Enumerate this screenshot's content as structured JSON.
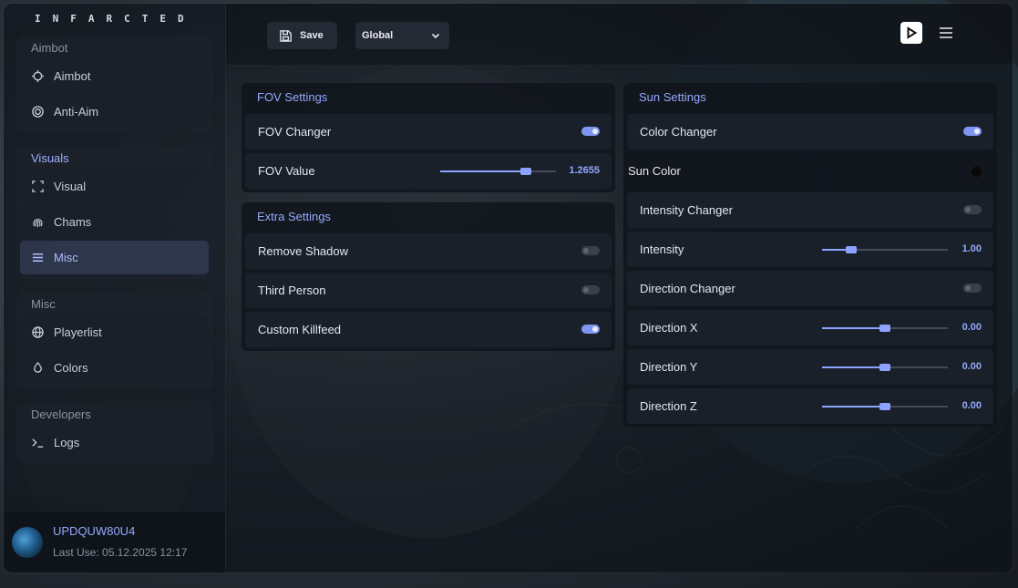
{
  "app": {
    "brand": "INFARCTED"
  },
  "sidebar": {
    "groups": [
      {
        "title": "Aimbot",
        "items": [
          {
            "label": "Aimbot",
            "icon": "crosshair-icon"
          },
          {
            "label": "Anti-Aim",
            "icon": "target-icon"
          }
        ]
      },
      {
        "title": "Visuals",
        "items": [
          {
            "label": "Visual",
            "icon": "frame-icon"
          },
          {
            "label": "Chams",
            "icon": "fingerprint-icon"
          },
          {
            "label": "Misc",
            "icon": "list-icon"
          }
        ]
      },
      {
        "title": "Misc",
        "items": [
          {
            "label": "Playerlist",
            "icon": "globe-icon"
          },
          {
            "label": "Colors",
            "icon": "droplet-icon"
          }
        ]
      },
      {
        "title": "Developers",
        "items": [
          {
            "label": "Logs",
            "icon": "terminal-icon"
          }
        ]
      }
    ],
    "selected": "Misc"
  },
  "user": {
    "name": "UPDQUW80U4",
    "last_use": "Last Use: 05.12.2025 12:17"
  },
  "toolbar": {
    "save_label": "Save",
    "config_select": "Global"
  },
  "panels": {
    "fov": {
      "title": "FOV Settings",
      "fov_changer": {
        "label": "FOV Changer",
        "on": true
      },
      "fov_value": {
        "label": "FOV Value",
        "value": "1.2655",
        "fraction": 0.74
      }
    },
    "extra": {
      "title": "Extra Settings",
      "remove_shadow": {
        "label": "Remove Shadow",
        "on": false
      },
      "third_person": {
        "label": "Third Person",
        "on": false
      },
      "custom_killfeed": {
        "label": "Custom Killfeed",
        "on": true
      }
    },
    "sun": {
      "title": "Sun Settings",
      "color_changer": {
        "label": "Color Changer",
        "on": true
      },
      "sun_color": {
        "label": "Sun Color",
        "color": "#080808"
      },
      "intensity_changer": {
        "label": "Intensity Changer",
        "on": false
      },
      "intensity": {
        "label": "Intensity",
        "value": "1.00",
        "fraction": 0.23
      },
      "direction_changer": {
        "label": "Direction Changer",
        "on": false
      },
      "direction_x": {
        "label": "Direction X",
        "value": "0.00",
        "fraction": 0.5
      },
      "direction_y": {
        "label": "Direction Y",
        "value": "0.00",
        "fraction": 0.5
      },
      "direction_z": {
        "label": "Direction Z",
        "value": "0.00",
        "fraction": 0.5
      }
    }
  },
  "colors": {
    "accent": "#8ea3ff",
    "toggle_on": "#7f97f2",
    "toggle_off": "#3b3f48"
  }
}
